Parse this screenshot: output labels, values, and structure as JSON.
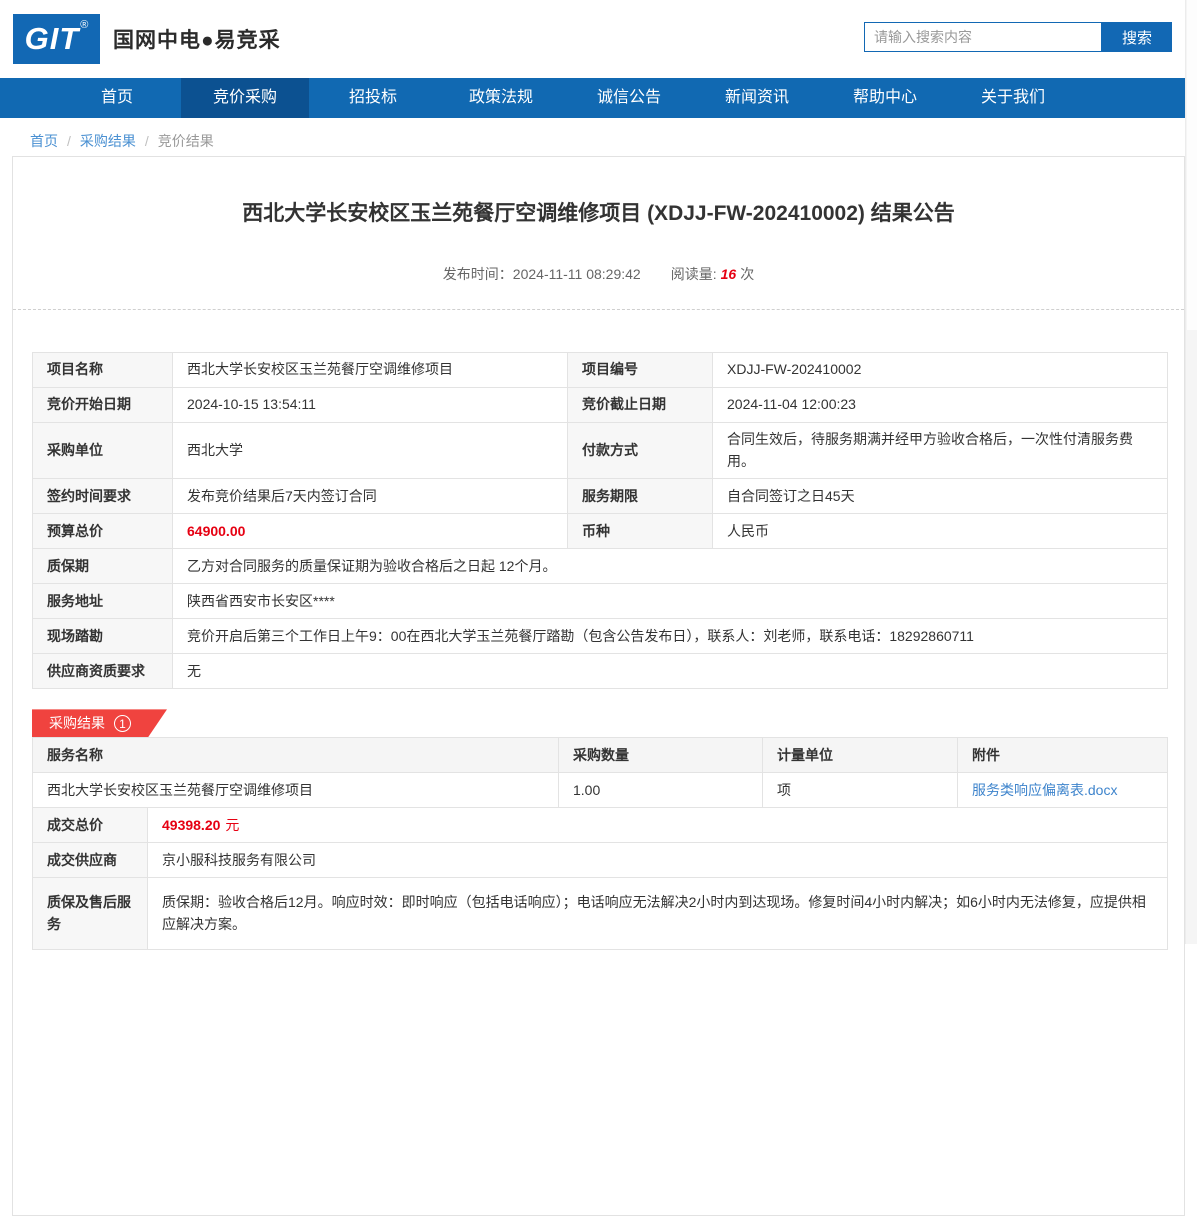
{
  "colors": {
    "nav_blue": "#1169b2",
    "nav_active_blue": "#0c5191",
    "brand_blue": "#1268b4",
    "ribbon_red": "#f0433f",
    "price_red": "#e60012",
    "link_blue": "#3e84cc"
  },
  "header": {
    "logo_text": "GIT",
    "logo_reg": "®",
    "brand": "国网中电●易竞采",
    "search": {
      "placeholder": "请输入搜索内容",
      "button_label": "搜索"
    }
  },
  "nav": {
    "items": [
      {
        "label": "首页",
        "active": false
      },
      {
        "label": "竞价采购",
        "active": true
      },
      {
        "label": "招投标",
        "active": false
      },
      {
        "label": "政策法规",
        "active": false
      },
      {
        "label": "诚信公告",
        "active": false
      },
      {
        "label": "新闻资讯",
        "active": false
      },
      {
        "label": "帮助中心",
        "active": false
      },
      {
        "label": "关于我们",
        "active": false
      }
    ]
  },
  "breadcrumb": {
    "separator": "/",
    "home": "首页",
    "parent": "采购结果",
    "current": "竞价结果"
  },
  "announcement": {
    "title": "西北大学长安校区玉兰苑餐厅空调维修项目 (XDJJ-FW-202410002) 结果公告",
    "publish_label": "发布时间：",
    "publish_time": "2024-11-11 08:29:42",
    "views_label": "阅读量:",
    "views_count": "16",
    "views_unit": "次"
  },
  "details": {
    "project_name": {
      "label": "项目名称",
      "value": "西北大学长安校区玉兰苑餐厅空调维修项目"
    },
    "project_code": {
      "label": "项目编号",
      "value": "XDJJ-FW-202410002"
    },
    "bid_start": {
      "label": "竞价开始日期",
      "value": "2024-10-15 13:54:11"
    },
    "bid_end": {
      "label": "竞价截止日期",
      "value": "2024-11-04 12:00:23"
    },
    "purchaser": {
      "label": "采购单位",
      "value": "西北大学"
    },
    "payment": {
      "label": "付款方式",
      "value": "合同生效后，待服务期满并经甲方验收合格后，一次性付清服务费用。"
    },
    "sign_time": {
      "label": "签约时间要求",
      "value": "发布竞价结果后7天内签订合同"
    },
    "service_period": {
      "label": "服务期限",
      "value": "自合同签订之日45天"
    },
    "budget": {
      "label": "预算总价",
      "value": "64900.00"
    },
    "currency": {
      "label": "币种",
      "value": "人民币"
    },
    "warranty": {
      "label": "质保期",
      "value": "乙方对合同服务的质量保证期为验收合格后之日起 12个月。"
    },
    "address": {
      "label": "服务地址",
      "value": "陕西省西安市长安区****"
    },
    "site_visit": {
      "label": "现场踏勘",
      "value": "竞价开启后第三个工作日上午9：00在西北大学玉兰苑餐厅踏勘（包含公告发布日），联系人：刘老师，联系电话：18292860711"
    },
    "qualification": {
      "label": "供应商资质要求",
      "value": "无"
    }
  },
  "result": {
    "badge": {
      "label": "采购结果",
      "count": "1"
    },
    "headers": [
      "服务名称",
      "采购数量",
      "计量单位",
      "附件"
    ],
    "item": {
      "service_name": "西北大学长安校区玉兰苑餐厅空调维修项目",
      "quantity": "1.00",
      "unit": "项",
      "attachment": "服务类响应偏离表.docx"
    },
    "deal_price": {
      "label": "成交总价",
      "value": "49398.20",
      "unit": "元"
    },
    "supplier": {
      "label": "成交供应商",
      "value": "京小服科技服务有限公司"
    },
    "after_sale": {
      "label": "质保及售后服务",
      "value": "质保期：验收合格后12月。响应时效：即时响应（包括电话响应）；电话响应无法解决2小时内到达现场。修复时间4小时内解决；如6小时内无法修复，应提供相应解决方案。"
    }
  }
}
